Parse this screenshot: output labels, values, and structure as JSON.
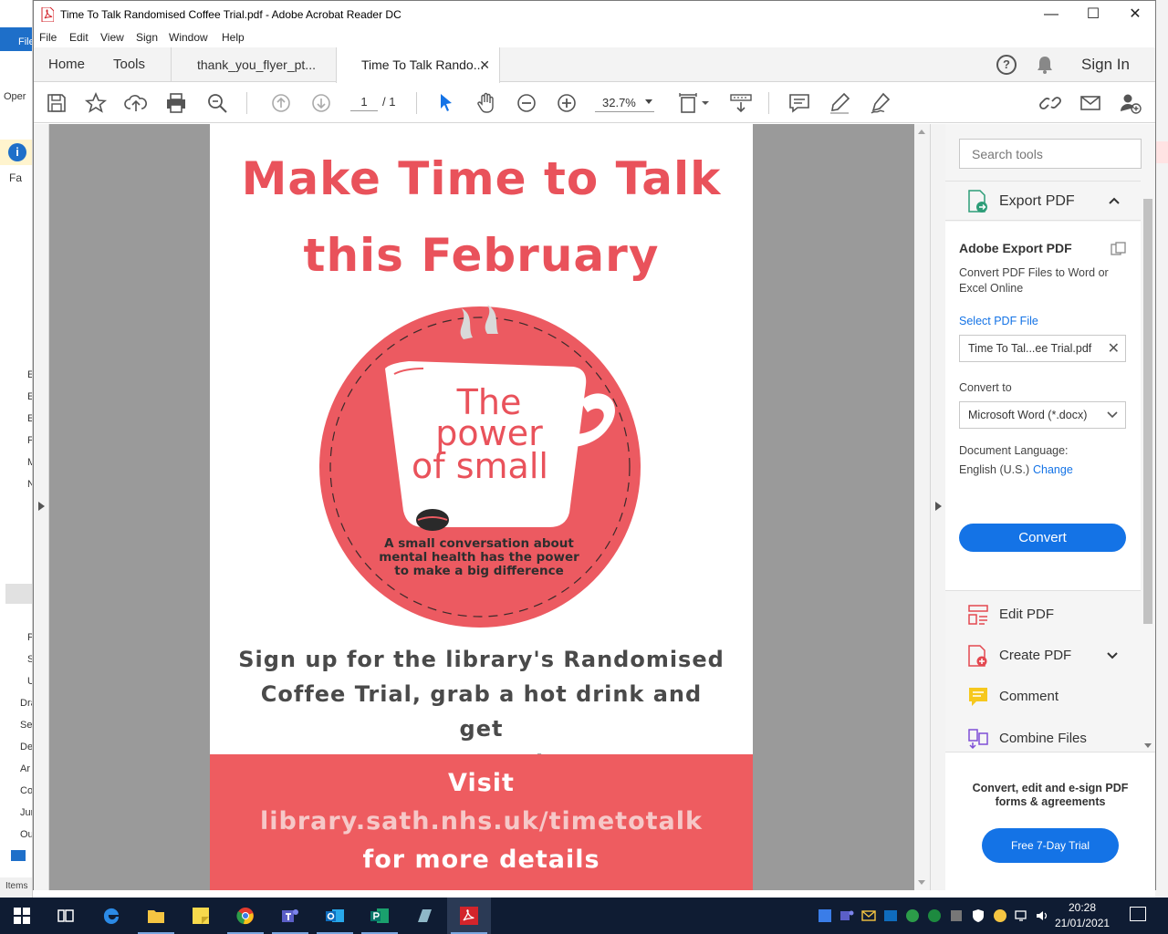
{
  "window": {
    "title": "Time To Talk Randomised Coffee Trial.pdf - Adobe Acrobat Reader DC",
    "minimize": "—",
    "maximize": "☐",
    "close": "✕"
  },
  "menu": [
    "File",
    "Edit",
    "View",
    "Sign",
    "Window",
    "Help"
  ],
  "tabs": {
    "home": "Home",
    "tools": "Tools",
    "doc1": "thank_you_flyer_pt...",
    "doc2": "Time To Talk Rando...",
    "doc2_close": "✕",
    "sign_in": "Sign In",
    "help": "?"
  },
  "toolbar": {
    "page_current": "1",
    "page_total": "/ 1",
    "zoom": "32.7%"
  },
  "document": {
    "headline_line1": "Make Time to Talk",
    "headline_line2": "this February",
    "logo_text_line1": "The",
    "logo_text_line2": "power",
    "logo_text_line3": "of small",
    "logo_tag_line1": "A small conversation about",
    "logo_tag_line2": "mental health has the power",
    "logo_tag_line3": "to make a big difference",
    "signup_line1": "Sign up for the library's Randomised",
    "signup_line2": "Coffee Trial, grab a hot drink and get",
    "signup_line3": "connected!",
    "banner_line1": "Visit",
    "banner_line2": "library.sath.nhs.uk/timetotalk",
    "banner_line3": "for more details",
    "colors": {
      "headline": "#e9525b",
      "banner": "#ee5c60",
      "link": "#f6c8c8"
    }
  },
  "tools_pane": {
    "search_placeholder": "Search tools",
    "export_label": "Export PDF",
    "export_title": "Adobe Export PDF",
    "export_desc": "Convert PDF Files to Word or Excel Online",
    "select_file": "Select PDF File",
    "file_name": "Time To Tal...ee Trial.pdf",
    "convert_to_label": "Convert to",
    "convert_to_value": "Microsoft Word (*.docx)",
    "doc_lang_label": "Document Language:",
    "doc_lang_value": "English (U.S.)",
    "doc_lang_change": "Change",
    "convert_button": "Convert",
    "items": [
      "Edit PDF",
      "Create PDF",
      "Comment",
      "Combine Files"
    ],
    "promo_text": "Convert, edit and e-sign PDF forms & agreements",
    "trial_button": "Free 7-Day Trial",
    "accent": "#1473e6"
  },
  "background_app": {
    "ribbon_tab": "File",
    "open_label": "Oper",
    "items": [
      "Fa",
      "E",
      "E",
      "E",
      "F",
      "M",
      "N",
      "P",
      "S",
      "U",
      "Dra",
      "Sei",
      "De",
      "Ar",
      "Co",
      "Jur",
      "Ou"
    ],
    "status": "Items"
  },
  "taskbar": {
    "time": "20:28",
    "date": "21/01/2021"
  }
}
